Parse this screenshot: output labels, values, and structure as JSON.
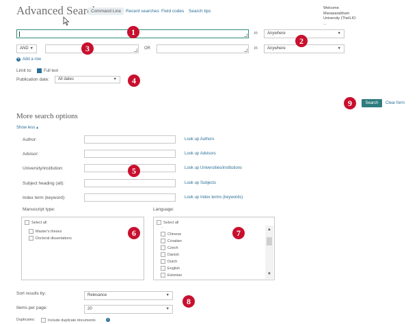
{
  "header": {
    "title": "Advanced Search",
    "tabs": [
      "Command Line",
      "Recent searches",
      "Field codes",
      "Search tips"
    ],
    "welcome_lines": [
      "Welcome",
      "Manasarabham",
      "University (TheILIO",
      "..."
    ]
  },
  "query": {
    "row1": {
      "in_label": "in",
      "field_value": "Anywhere"
    },
    "row2": {
      "operator": "AND",
      "middle_label": "OR",
      "in_label": "in",
      "field_value": "Anywhere"
    },
    "add_row": "Add a row"
  },
  "limits": {
    "limit_to_label": "Limit to:",
    "full_text_label": "Full text",
    "pubdate_label": "Publication date:",
    "pubdate_value": "All dates"
  },
  "actions": {
    "search": "Search",
    "clear": "Clear form"
  },
  "more": {
    "title": "More search options",
    "show_less": "Show less ▴",
    "rows": [
      {
        "label": "Author:",
        "lookup": "Look up Authors"
      },
      {
        "label": "Advisor:",
        "lookup": "Look up Advisors"
      },
      {
        "label": "University/institution:",
        "lookup": "Look up Universities/institutions"
      },
      {
        "label": "Subject heading (all):",
        "lookup": "Look up Subjects"
      },
      {
        "label": "Index term (keyword):",
        "lookup": "Look up Index terms (keywords)"
      }
    ],
    "manuscript_label": "Manuscript type:",
    "manuscript_items": [
      "Select all",
      "Master's theses",
      "Doctoral dissertations"
    ],
    "language_label": "Language:",
    "language_items": [
      "Select all",
      "...",
      "Chinese",
      "Croatian",
      "Czech",
      "Danish",
      "Dutch",
      "English",
      "Estonian"
    ]
  },
  "sort": {
    "sort_label": "Sort results by:",
    "sort_value": "Relevance",
    "items_label": "Items per page:",
    "items_value": "20",
    "duplicates_label": "Duplicates:",
    "duplicates_option": "Include duplicate documents"
  },
  "annotations": [
    "1",
    "2",
    "3",
    "4",
    "5",
    "6",
    "7",
    "8",
    "9"
  ],
  "colors": {
    "badge": "#c8102e",
    "accent": "#2e7c7e",
    "link": "#2a6f97"
  }
}
